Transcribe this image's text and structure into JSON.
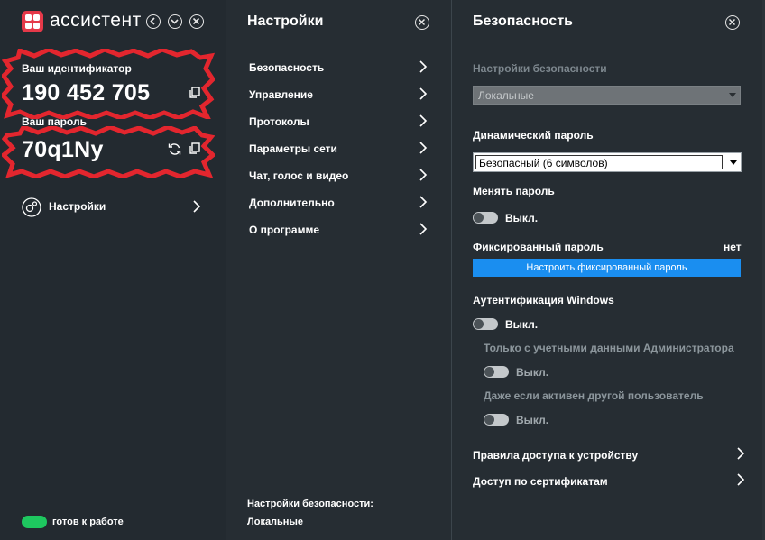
{
  "app": {
    "title": "ассистент",
    "logo_color": "#e53949"
  },
  "left": {
    "id_label": "Ваш идентификатор",
    "id_value": "190 452 705",
    "password_label": "Ваш пароль",
    "password_value": "70q1Ny",
    "settings_label": "Настройки",
    "status_text": "готов к работе",
    "status_color": "#1ec75f",
    "icons": [
      "back-icon",
      "chevron-down-icon",
      "close-icon",
      "copy-icon",
      "refresh-icon",
      "gear-icon",
      "chevron-right-icon"
    ]
  },
  "middle": {
    "title": "Настройки",
    "items": [
      {
        "label": "Безопасность"
      },
      {
        "label": "Управление"
      },
      {
        "label": "Протоколы"
      },
      {
        "label": "Параметры сети"
      },
      {
        "label": "Чат, голос и видео"
      },
      {
        "label": "Дополнительно"
      },
      {
        "label": "О программе"
      }
    ],
    "footer_label": "Настройки безопасности:",
    "footer_value": "Локальные"
  },
  "right": {
    "title": "Безопасность",
    "security_settings_label": "Настройки безопасности",
    "security_settings_value": "Локальные",
    "dynamic_password_label": "Динамический пароль",
    "dynamic_password_value": "Безопасный (6 символов)",
    "change_password_label": "Менять пароль",
    "change_password_state": "Выкл.",
    "fixed_password_label": "Фиксированный пароль",
    "fixed_password_value": "нет",
    "fixed_password_button": "Настроить фиксированный пароль",
    "windows_auth_label": "Аутентификация Windows",
    "windows_auth_state": "Выкл.",
    "admin_only_label": "Только с учетными данными Администратора",
    "admin_only_state": "Выкл.",
    "other_user_label": "Даже если активен другой пользователь",
    "other_user_state": "Выкл.",
    "device_access_label": "Правила доступа к устройству",
    "cert_access_label": "Доступ по сертификатам",
    "accent_color": "#1a8ef0"
  }
}
